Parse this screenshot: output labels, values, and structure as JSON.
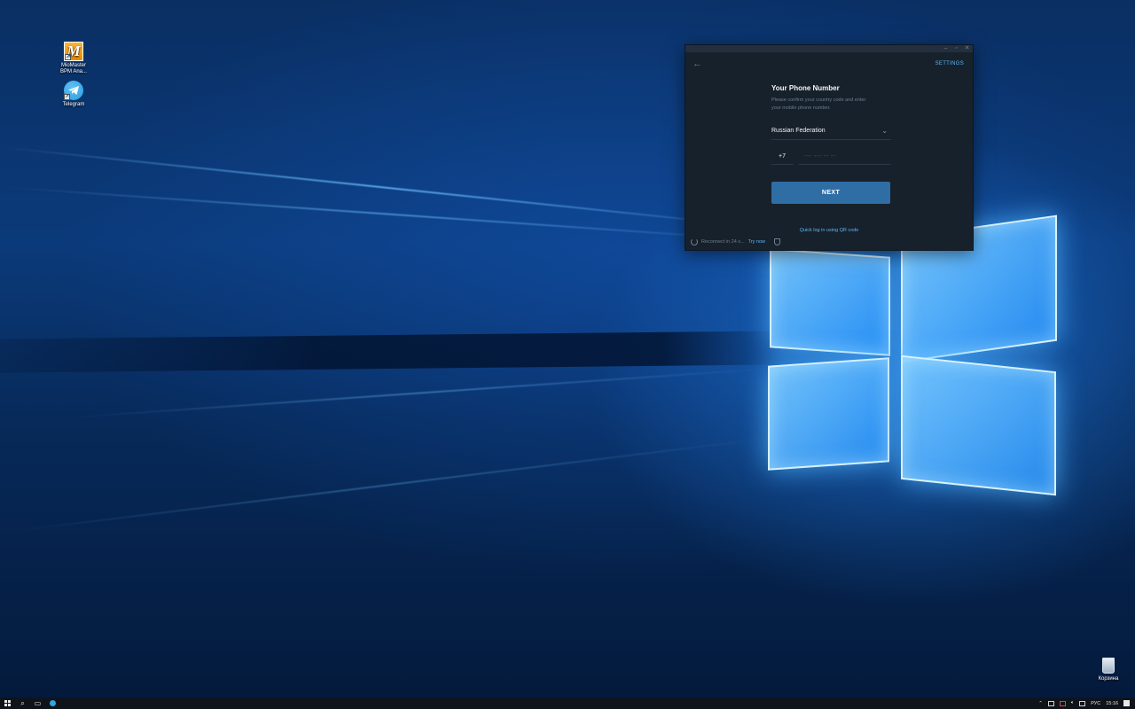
{
  "desktop": {
    "icons": [
      {
        "label_line1": "MioMaster",
        "label_line2": "BPM Ana...",
        "icon": "miomaster-app-icon"
      },
      {
        "label_line1": "Telegram",
        "label_line2": "",
        "icon": "telegram-app-icon"
      }
    ],
    "recycle_bin": {
      "label": "Корзина",
      "icon": "recycle-bin-icon"
    }
  },
  "telegram": {
    "settings_label": "SETTINGS",
    "title": "Your Phone Number",
    "description": "Please confirm your country code and enter your mobile phone number.",
    "country": "Russian Federation",
    "country_code": "+7",
    "phone_placeholder": "--- --- -- --",
    "next_label": "NEXT",
    "qr_link": "Quick log in using QR code",
    "reconnect_text": "Reconnect in 24 s...",
    "try_now": "Try now",
    "accent_color": "#5eb5f7",
    "button_color": "#2f6ea5"
  },
  "taskbar": {
    "language": "РУС",
    "time": "15:16"
  }
}
